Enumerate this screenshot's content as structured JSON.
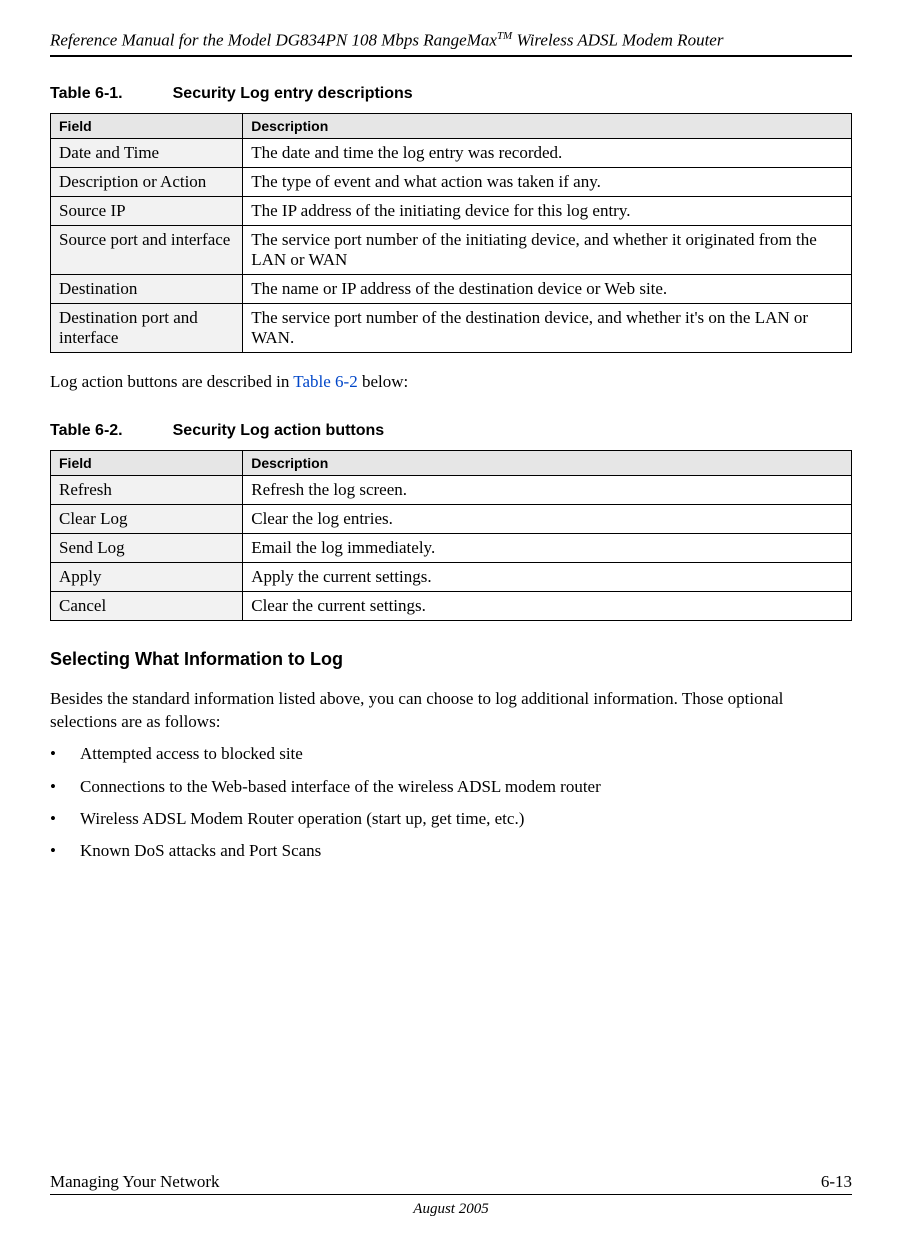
{
  "header": {
    "title_pre": "Reference Manual for the Model DG834PN 108 Mbps RangeMax",
    "tm": "TM",
    "title_post": " Wireless ADSL Modem Router"
  },
  "table61": {
    "number": "Table 6-1.",
    "title": "Security Log entry descriptions",
    "headers": {
      "field": "Field",
      "desc": "Description"
    },
    "rows": [
      {
        "field": "Date and Time",
        "desc": "The date and time the log entry was recorded."
      },
      {
        "field": "Description or Action",
        "desc": "The type of event and what action was taken if any."
      },
      {
        "field": "Source IP",
        "desc": "The IP address of the initiating device for this log entry."
      },
      {
        "field": "Source port and interface",
        "desc": "The service port number of the initiating device, and whether it originated from the LAN or WAN"
      },
      {
        "field": "Destination",
        "desc": "The name or IP address of the destination device or Web site."
      },
      {
        "field": "Destination port and interface",
        "desc": "The service port number of the destination device, and whether it's on the LAN or WAN."
      }
    ]
  },
  "para1": {
    "pre": "Log action buttons are described in ",
    "ref": "Table 6-2",
    "post": " below:"
  },
  "table62": {
    "number": "Table 6-2.",
    "title": "Security Log action buttons",
    "headers": {
      "field": "Field",
      "desc": "Description"
    },
    "rows": [
      {
        "field": "Refresh",
        "desc": "Refresh the log screen."
      },
      {
        "field": "Clear Log",
        "desc": "Clear the log entries."
      },
      {
        "field": "Send Log",
        "desc": "Email the log immediately."
      },
      {
        "field": "Apply",
        "desc": "Apply the current settings."
      },
      {
        "field": "Cancel",
        "desc": "Clear the current settings."
      }
    ]
  },
  "section": {
    "heading": "Selecting What Information to Log",
    "intro": "Besides the standard information listed above, you can choose to log additional information. Those optional selections are as follows:",
    "items": [
      "Attempted access to blocked site",
      "Connections to the Web-based interface of the wireless ADSL modem router",
      "Wireless ADSL Modem Router operation (start up, get time, etc.)",
      "Known DoS attacks and Port Scans"
    ]
  },
  "footer": {
    "left": "Managing Your Network",
    "right": "6-13",
    "date": "August 2005"
  }
}
